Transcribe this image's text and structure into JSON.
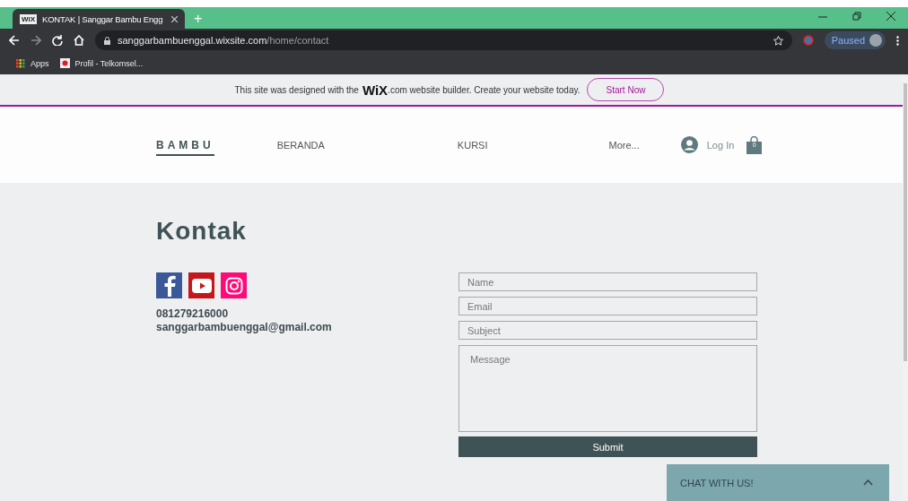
{
  "browser": {
    "tab": {
      "title": "KONTAK | Sanggar Bambu Engg",
      "favicon": "WiX"
    },
    "new_tab": "+",
    "url": {
      "host": "sanggarbambuenggal.wixsite.com",
      "path": "/home/contact"
    },
    "profile": "Paused",
    "bookmarks": [
      {
        "label": "Apps",
        "kind": "apps"
      },
      {
        "label": "Profil - Telkomsel...",
        "kind": "site"
      }
    ]
  },
  "banner": {
    "before": "This site was designed with the",
    "logo": "WiX",
    "after": ".com website builder. Create your website today.",
    "button": "Start Now"
  },
  "nav": {
    "brand": "BAMBU",
    "items": [
      {
        "label": "BERANDA",
        "selected": false
      },
      {
        "label": "KURSI",
        "selected": false
      },
      {
        "label": "More...",
        "selected": false
      }
    ],
    "login": "Log In",
    "cart_count": "0"
  },
  "page": {
    "title": "Kontak",
    "phone": "081279216000",
    "email": "sanggarbambuenggal@gmail.com"
  },
  "form": {
    "fields": [
      {
        "placeholder": "Name",
        "kind": "input"
      },
      {
        "placeholder": "Email",
        "kind": "input"
      },
      {
        "placeholder": "Subject",
        "kind": "input"
      },
      {
        "placeholder": "Message",
        "kind": "textarea"
      }
    ],
    "submit": "Submit"
  },
  "chat": {
    "label": "CHAT WITH US!",
    "expanded": false
  }
}
